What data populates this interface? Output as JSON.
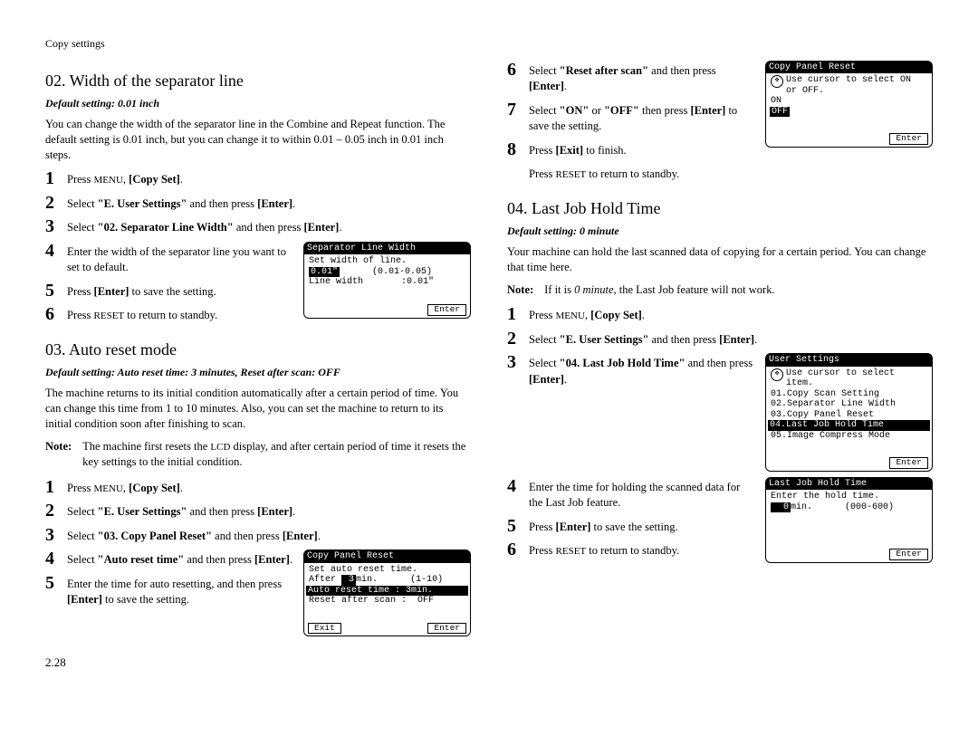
{
  "header": "Copy settings",
  "page_number": "2.28",
  "sections": [
    {
      "id": "s02",
      "title": "02. Width of the separator line",
      "default": "Default setting: 0.01 inch",
      "intro": "You can change the width of the separator line in the Combine and Repeat function. The default setting is 0.01 inch, but you can change it to within 0.01 – 0.05 inch in 0.01 inch steps.",
      "steps": {
        "s1": "Press MENU, [Copy Set].",
        "s2": "Select \"E. User Settings\" and then press [Enter].",
        "s3": "Select \"02. Separator Line Width\" and then press [Enter].",
        "s4": "Enter the width of the separator line you want to set to default.",
        "s5": "Press [Enter] to save the setting.",
        "s6": "Press RESET to return to standby."
      },
      "lcd": {
        "title": "Separator Line Width",
        "l1": "Set width of line.",
        "val": "0.01\"",
        "range": "(0.01-0.05)",
        "l3": "Line width       :0.01\"",
        "enter": "Enter"
      }
    },
    {
      "id": "s03",
      "title": "03. Auto reset mode",
      "default": "Default setting: Auto reset time: 3 minutes, Reset after scan: OFF",
      "intro": "The machine returns to its initial condition automatically after a certain period of time. You can change this time from 1 to 10 minutes. Also, you can set the machine to return to its initial condition soon after finishing to scan.",
      "note_label": "Note:",
      "note": "The machine first resets the LCD display, and after certain period of time it resets the key settings to the initial condition.",
      "steps": {
        "s1": "Press MENU, [Copy Set].",
        "s2": "Select \"E. User Settings\" and then press [Enter].",
        "s3": "Select \"03. Copy Panel Reset\" and then press [Enter].",
        "s4": "Select \"Auto reset time\" and then press [Enter].",
        "s5": "Enter the time for auto resetting, and then press [Enter] to save the setting.",
        "s6": "Select \"Reset after scan\" and then press [Enter].",
        "s7": "Select \"ON\" or \"OFF\" then press [Enter] to save the setting.",
        "s8": "Press [Exit] to finish.",
        "post": "Press RESET to return to standby."
      },
      "lcd1": {
        "title": "Copy Panel Reset",
        "l1": "Set auto reset time.",
        "l2a": "After ",
        "l2val": " 3",
        "l2b": "min.",
        "l2range": "(1-10)",
        "l3": "Auto reset time  :  3min.",
        "l4": "Reset after scan :  OFF",
        "exit": "Exit",
        "enter": "Enter"
      },
      "lcd2": {
        "title": "Copy Panel Reset",
        "hint": "Use cursor to select ON or OFF.",
        "on": "ON",
        "off": "OFF",
        "enter": "Enter"
      }
    },
    {
      "id": "s04",
      "title": "04. Last Job Hold Time",
      "default": "Default setting: 0 minute",
      "intro": "Your machine can hold the last scanned data of copying for a certain period. You can change that time here.",
      "note_label": "Note:",
      "note": "If it is 0 minute, the Last Job feature will not work.",
      "steps": {
        "s1": "Press MENU, [Copy Set].",
        "s2": "Select \"E. User Settings\" and then press [Enter].",
        "s3": "Select \"04. Last Job Hold Time\" and then press [Enter].",
        "s4": "Enter the time for holding the scanned data for the Last Job feature.",
        "s5": "Press [Enter] to save the setting.",
        "s6": "Press RESET to return to standby."
      },
      "lcd1": {
        "title": "User Settings",
        "hint": "Use cursor to select item.",
        "i1": "01.Copy Scan Setting",
        "i2": "02.Separator Line Width",
        "i3": "03.Copy Panel Reset",
        "i4": "04.Last Job Hold Time",
        "i5": "05.Image Compress Mode",
        "enter": "Enter"
      },
      "lcd2": {
        "title": "Last Job Hold Time",
        "l1": "Enter the hold time.",
        "val": "  0",
        "unit": "min.",
        "range": "(000-600)",
        "enter": "Enter"
      }
    }
  ]
}
